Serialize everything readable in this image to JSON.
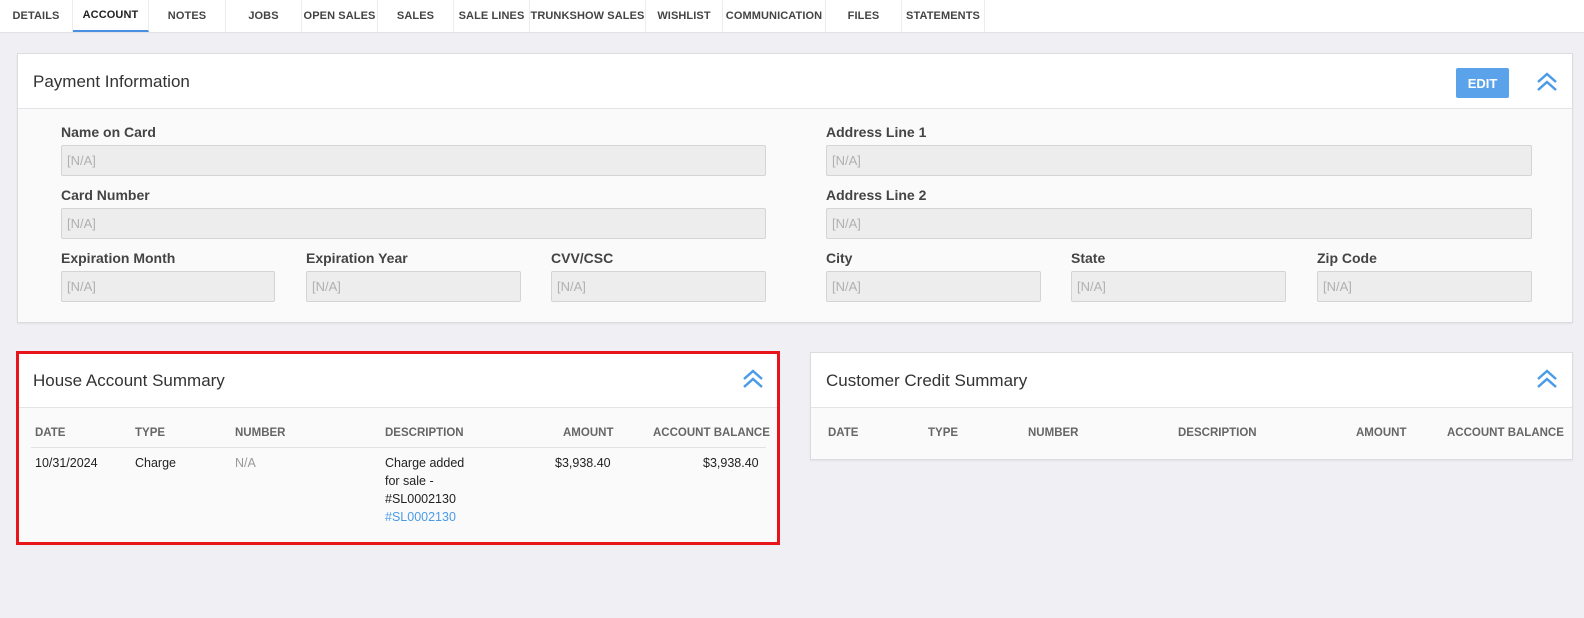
{
  "tabs": [
    {
      "label": "DETAILS",
      "active": false
    },
    {
      "label": "ACCOUNT",
      "active": true
    },
    {
      "label": "NOTES",
      "active": false
    },
    {
      "label": "JOBS",
      "active": false
    },
    {
      "label": "OPEN SALES",
      "active": false
    },
    {
      "label": "SALES",
      "active": false
    },
    {
      "label": "SALE LINES",
      "active": false
    },
    {
      "label": "TRUNKSHOW SALES",
      "active": false
    },
    {
      "label": "WISHLIST",
      "active": false
    },
    {
      "label": "COMMUNICATION",
      "active": false
    },
    {
      "label": "FILES",
      "active": false
    },
    {
      "label": "STATEMENTS",
      "active": false
    }
  ],
  "payment": {
    "title": "Payment Information",
    "edit_label": "EDIT",
    "name_on_card": {
      "label": "Name on Card",
      "placeholder": "[N/A]"
    },
    "card_number": {
      "label": "Card Number",
      "placeholder": "[N/A]"
    },
    "exp_month": {
      "label": "Expiration Month",
      "placeholder": "[N/A]"
    },
    "exp_year": {
      "label": "Expiration Year",
      "placeholder": "[N/A]"
    },
    "cvv": {
      "label": "CVV/CSC",
      "placeholder": "[N/A]"
    },
    "address1": {
      "label": "Address Line 1",
      "placeholder": "[N/A]"
    },
    "address2": {
      "label": "Address Line 2",
      "placeholder": "[N/A]"
    },
    "city": {
      "label": "City",
      "placeholder": "[N/A]"
    },
    "state": {
      "label": "State",
      "placeholder": "[N/A]"
    },
    "zip": {
      "label": "Zip Code",
      "placeholder": "[N/A]"
    }
  },
  "house": {
    "title": "House Account Summary",
    "headers": [
      "DATE",
      "TYPE",
      "NUMBER",
      "DESCRIPTION",
      "AMOUNT",
      "ACCOUNT BALANCE"
    ],
    "rows": [
      {
        "date": "10/31/2024",
        "type": "Charge",
        "number": "N/A",
        "description_lines": [
          "Charge added",
          "for sale -",
          "#SL0002130"
        ],
        "description_link": "#SL0002130",
        "amount": "$3,938.40",
        "balance": "$3,938.40"
      }
    ]
  },
  "credit": {
    "title": "Customer Credit Summary",
    "headers": [
      "DATE",
      "TYPE",
      "NUMBER",
      "DESCRIPTION",
      "AMOUNT",
      "ACCOUNT BALANCE"
    ]
  },
  "colors": {
    "accent": "#4a9be8",
    "edit_button": "#5aa3ea",
    "highlight": "#e8141b"
  }
}
